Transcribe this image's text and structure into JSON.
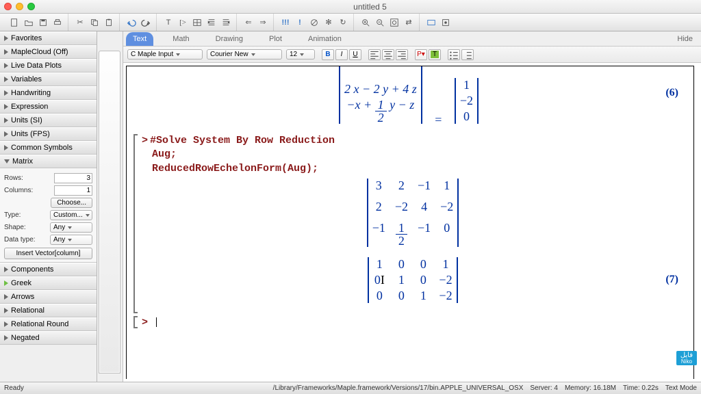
{
  "window": {
    "title": "untitled 5"
  },
  "sidebar": {
    "items": [
      {
        "label": "Favorites"
      },
      {
        "label": "MapleCloud (Off)"
      },
      {
        "label": "Live Data Plots"
      },
      {
        "label": "Variables"
      },
      {
        "label": "Handwriting"
      },
      {
        "label": "Expression"
      },
      {
        "label": "Units (SI)"
      },
      {
        "label": "Units (FPS)"
      },
      {
        "label": "Common Symbols"
      }
    ],
    "matrix_section": {
      "label": "Matrix"
    },
    "matrix": {
      "rows_label": "Rows:",
      "rows_value": "3",
      "cols_label": "Columns:",
      "cols_value": "1",
      "choose": "Choose...",
      "type_label": "Type:",
      "type_value": "Custom...",
      "shape_label": "Shape:",
      "shape_value": "Any",
      "datatype_label": "Data type:",
      "datatype_value": "Any",
      "insert": "Insert Vector[column]"
    },
    "items2": [
      {
        "label": "Components"
      },
      {
        "label": "Greek"
      },
      {
        "label": "Arrows"
      },
      {
        "label": "Relational"
      },
      {
        "label": "Relational Round"
      },
      {
        "label": "Negated"
      }
    ]
  },
  "context_tabs": {
    "text": "Text",
    "math": "Math",
    "drawing": "Drawing",
    "plot": "Plot",
    "animation": "Animation",
    "hide": "Hide"
  },
  "format_bar": {
    "style": "C Maple Input",
    "font": "Courier New",
    "size": "12",
    "bold": "B",
    "italic": "I",
    "under": "U"
  },
  "doc": {
    "eq6": "(6)",
    "eq_row2": "2 x − 2 y + 4 z",
    "eq_row3": "−x + ",
    "eq_row3_tail": " y − z",
    "rhs": [
      "1",
      "−2",
      "0"
    ],
    "comment": "#Solve System By Row Reduction",
    "line2": "Aug;",
    "line3": "ReducedRowEchelonForm(Aug);",
    "m1": [
      [
        "3",
        "2",
        "−1",
        "1"
      ],
      [
        "2",
        "−2",
        "4",
        "−2"
      ],
      [
        "−1",
        "",
        "−1",
        "0"
      ]
    ],
    "m2": [
      [
        "1",
        "0",
        "0",
        "1"
      ],
      [
        "0",
        "1",
        "0",
        "−2"
      ],
      [
        "0",
        "0",
        "1",
        "−2"
      ]
    ],
    "eq7": "(7)"
  },
  "status": {
    "ready": "Ready",
    "path": "/Library/Frameworks/Maple.framework/Versions/17/bin.APPLE_UNIVERSAL_OSX",
    "server": "Server: 4",
    "memory": "Memory: 16.18M",
    "time": "Time: 0.22s",
    "mode": "Text Mode"
  },
  "watermark": {
    "top": "فایل",
    "bottom": "Niko"
  }
}
